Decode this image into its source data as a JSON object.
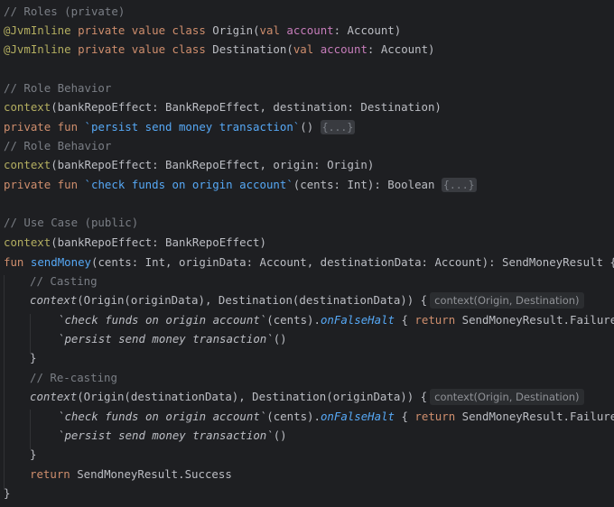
{
  "code": {
    "c_roles": "// Roles (private)",
    "ann_jvminline": "@JvmInline",
    "kw_private_value_class": "private value class",
    "origin_class": "Origin",
    "destination_class": "Destination",
    "kw_val": "val",
    "param_account": "account",
    "type_account": ": Account)",
    "c_role_behavior": "// Role Behavior",
    "kw_context": "context",
    "ctx_bank_dest": "(bankRepoEffect: BankRepoEffect, destination: Destination)",
    "kw_private_fun": "private fun",
    "fn_persist": "`persist send money transaction`",
    "persist_sig": "()",
    "fold_marker": "{...}",
    "ctx_bank_origin": "(bankRepoEffect: BankRepoEffect, origin: Origin)",
    "fn_check": "`check funds on origin account`",
    "check_sig": "(cents: Int): Boolean",
    "c_use_case": "// Use Case (public)",
    "ctx_bank": "(bankRepoEffect: BankRepoEffect)",
    "kw_fun": "fun",
    "fn_sendmoney": "sendMoney",
    "sendmoney_sig": "(cents: Int, originData: Account, destinationData: Account): SendMoneyResult {",
    "c_casting": "// Casting",
    "ctx_cast_1": "(Origin(originData), Destination(destinationData)) {",
    "hint_context": "context(Origin, Destination)",
    "call_check": "`check funds on origin account`",
    "check_call_args": "(cents).",
    "ext_onfalsehalt": "onFalseHalt",
    "brace_open": " { ",
    "kw_return": "return",
    "result_failure": " SendMoneyResult.Failure }",
    "call_persist": "`persist send money transaction`",
    "call_parens": "()",
    "brace_close": "}",
    "c_recasting": "// Re-casting",
    "ctx_cast_2": "(Origin(destinationData), Destination(originData)) {",
    "result_success": " SendMoneyResult.Success"
  }
}
